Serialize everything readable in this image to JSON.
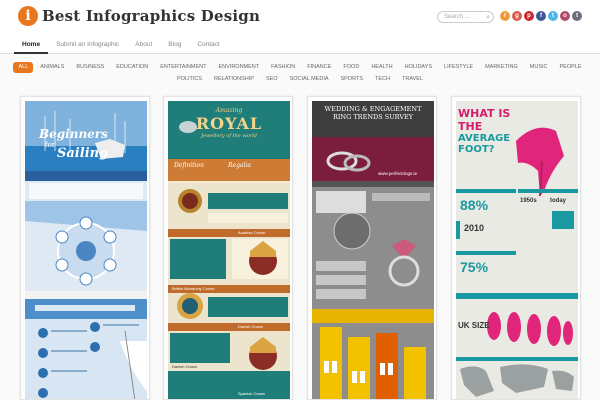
{
  "header": {
    "logo_letter": "i",
    "logo_text": "Best Infographics Design",
    "search_placeholder": "Search ...",
    "socials": [
      {
        "icon": "rss-icon",
        "glyph": "r",
        "color": "#f29a3a"
      },
      {
        "icon": "googleplus-icon",
        "glyph": "g",
        "color": "#d85b4a"
      },
      {
        "icon": "pinterest-icon",
        "glyph": "p",
        "color": "#c8282d"
      },
      {
        "icon": "facebook-icon",
        "glyph": "f",
        "color": "#3b5998"
      },
      {
        "icon": "twitter-icon",
        "glyph": "t",
        "color": "#4fb5e6"
      },
      {
        "icon": "instagram-icon",
        "glyph": "o",
        "color": "#b24b6b"
      },
      {
        "icon": "tumblr-icon",
        "glyph": "t",
        "color": "#6b6f7b"
      }
    ]
  },
  "nav": {
    "items": [
      "Home",
      "Submit an Infographic",
      "About",
      "Blog",
      "Contact"
    ]
  },
  "filters": {
    "row1": [
      "ALL",
      "ANIMALS",
      "BUSINESS",
      "EDUCATION",
      "ENTERTAINMENT",
      "ENVIRONMENT",
      "FASHION",
      "FINANCE",
      "FOOD",
      "HEALTH",
      "HOLIDAYS",
      "LIFESTYLE",
      "MARKETING",
      "MUSIC",
      "PEOPLE"
    ],
    "row2": [
      "POLITICS",
      "RELATIONSHIP",
      "SEO",
      "SOCIAL MEDIA",
      "SPORTS",
      "TECH",
      "TRAVEL"
    ]
  },
  "cards": {
    "sailing": {
      "title_line1": "Beginners",
      "title_line2": "Sailing",
      "title_prefix": "for"
    },
    "royal": {
      "kicker": "Amazing",
      "title": "ROYAL",
      "subtitle": "Jewellery of the world",
      "section1": "Definition",
      "section2": "Regalia",
      "crown1": "Austrian Crown",
      "crown2": "British Monarchy Crown",
      "crown3": "Danish Crown",
      "crown4": "Danish Crown",
      "crown5": "Spanish Crown"
    },
    "wedding": {
      "title_line1": "WEDDING & ENGAGEMENT",
      "title_line2": "RING TRENDS SURVEY",
      "url": "www.perfectrings.ie"
    },
    "foot": {
      "title_line1": "WHAT IS THE",
      "title_line2": "AVERAGE FOOT?",
      "stat1": "88%",
      "year1": "1950s",
      "year2": "today",
      "stat2": "2010",
      "stat3": "75%",
      "uk_label": "UK SIZE"
    }
  }
}
